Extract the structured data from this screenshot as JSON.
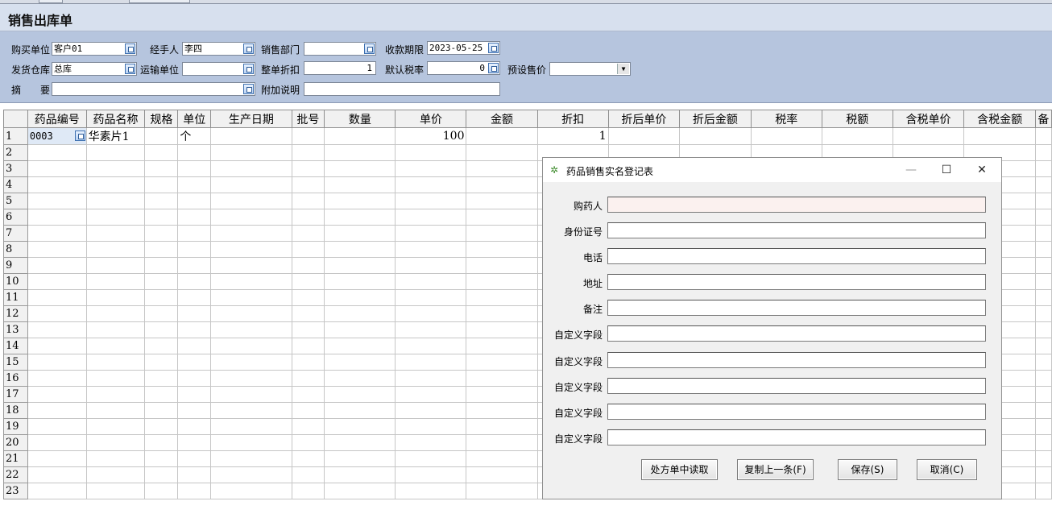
{
  "window": {
    "title": "销售出库单"
  },
  "header": {
    "buyer_label": "购买单位",
    "buyer_value": "客户01",
    "handler_label": "经手人",
    "handler_value": "李四",
    "dept_label": "销售部门",
    "dept_value": "",
    "due_label": "收款期限",
    "due_value": "2023-05-25",
    "warehouse_label": "发货仓库",
    "warehouse_value": "总库",
    "carrier_label": "运输单位",
    "carrier_value": "",
    "discount_label": "整单折扣",
    "discount_value": "1",
    "taxrate_label": "默认税率",
    "taxrate_value": "0",
    "preset_price_label": "预设售价",
    "preset_price_value": "",
    "summary_label": "摘　　要",
    "summary_value": "",
    "note_label": "附加说明",
    "note_value": ""
  },
  "grid": {
    "columns": [
      "药品编号",
      "药品名称",
      "规格",
      "单位",
      "生产日期",
      "批号",
      "数量",
      "单价",
      "金额",
      "折扣",
      "折后单价",
      "折后金额",
      "税率",
      "税额",
      "含税单价",
      "含税金额",
      "备"
    ],
    "rows": [
      [
        "1",
        "0003",
        "华素片1",
        "",
        "个",
        "",
        "",
        "",
        "100",
        "",
        "1",
        "",
        "",
        "",
        "",
        "",
        "",
        ""
      ],
      [
        "2"
      ],
      [
        "3"
      ],
      [
        "4"
      ],
      [
        "5"
      ],
      [
        "6"
      ],
      [
        "7"
      ],
      [
        "8"
      ],
      [
        "9"
      ],
      [
        "10"
      ],
      [
        "11"
      ],
      [
        "12"
      ],
      [
        "13"
      ],
      [
        "14"
      ],
      [
        "15"
      ],
      [
        "16"
      ],
      [
        "17"
      ],
      [
        "18"
      ],
      [
        "19"
      ],
      [
        "20"
      ],
      [
        "21"
      ],
      [
        "22"
      ],
      [
        "23"
      ]
    ]
  },
  "dialog": {
    "title": "药品销售实名登记表",
    "fields": [
      {
        "label": "购药人",
        "value": ""
      },
      {
        "label": "身份证号",
        "value": ""
      },
      {
        "label": "电话",
        "value": ""
      },
      {
        "label": "地址",
        "value": ""
      },
      {
        "label": "备注",
        "value": ""
      },
      {
        "label": "自定义字段",
        "value": ""
      },
      {
        "label": "自定义字段",
        "value": ""
      },
      {
        "label": "自定义字段",
        "value": ""
      },
      {
        "label": "自定义字段",
        "value": ""
      },
      {
        "label": "自定义字段",
        "value": ""
      }
    ],
    "buttons": {
      "read_prescription": "处方单中读取",
      "copy_previous": "复制上一条(F)",
      "save": "保存(S)",
      "cancel": "取消(C)"
    },
    "controls": {
      "minimize": "—",
      "maximize": "☐",
      "close": "✕"
    }
  }
}
